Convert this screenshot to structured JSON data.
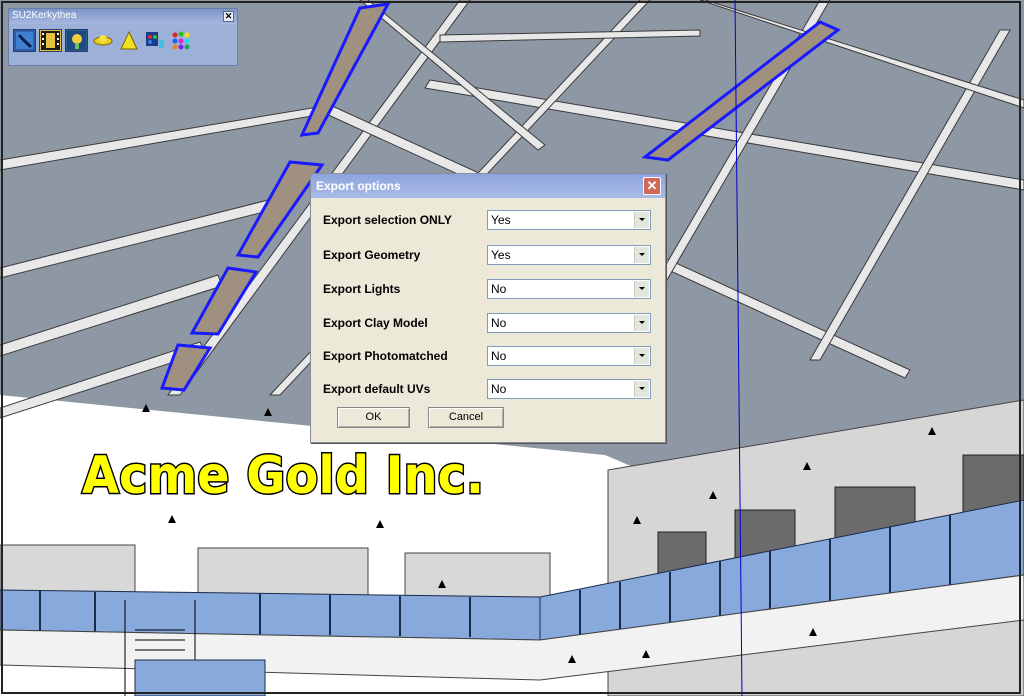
{
  "scene": {
    "sign_text": "Acme Gold Inc."
  },
  "toolbar": {
    "title": "SU2Kerkythea",
    "close_glyph": "✕",
    "buttons": [
      {
        "icon": "export-scene-icon"
      },
      {
        "icon": "export-animation-icon"
      },
      {
        "icon": "settings-icon"
      },
      {
        "icon": "omni-light-icon"
      },
      {
        "icon": "spot-light-icon"
      },
      {
        "icon": "material-editor-icon"
      },
      {
        "icon": "palette-icon"
      }
    ]
  },
  "dialog": {
    "title": "Export options",
    "close_glyph": "✕",
    "rows": [
      {
        "label": "Export selection ONLY",
        "value": "Yes"
      },
      {
        "label": "Export Geometry",
        "value": "Yes"
      },
      {
        "label": "Export Lights",
        "value": "No"
      },
      {
        "label": "Export Clay Model",
        "value": "No"
      },
      {
        "label": "Export Photomatched",
        "value": "No"
      },
      {
        "label": "Export default UVs",
        "value": "No"
      }
    ],
    "ok_label": "OK",
    "cancel_label": "Cancel"
  },
  "colors": {
    "dialog_title": "#8da4dd",
    "toolbar_bg": "#9db1d8",
    "selection_blue": "#0000ff",
    "sign_yellow": "#ffff00"
  }
}
